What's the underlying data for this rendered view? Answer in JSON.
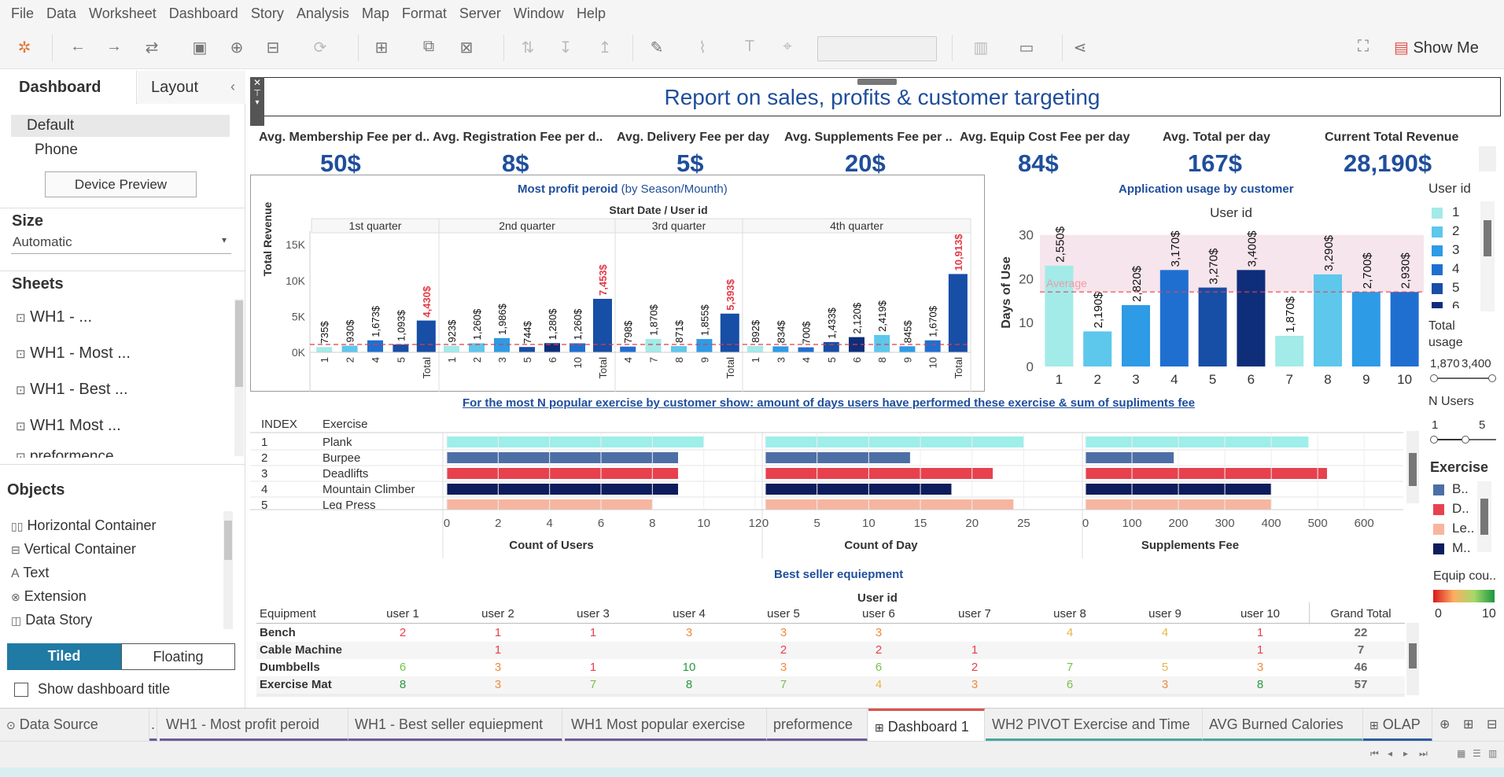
{
  "menu": [
    "File",
    "Data",
    "Worksheet",
    "Dashboard",
    "Story",
    "Analysis",
    "Map",
    "Format",
    "Server",
    "Window",
    "Help"
  ],
  "toolbar": {
    "show_me": "Show Me"
  },
  "left": {
    "tabs": [
      "Dashboard",
      "Layout"
    ],
    "device": {
      "default": "Default",
      "phone": "Phone",
      "preview_button": "Device Preview"
    },
    "size": {
      "title": "Size",
      "value": "Automatic"
    },
    "sheets": {
      "title": "Sheets",
      "items": [
        "WH1 - ...",
        "WH1 - Most ...",
        "WH1 - Best ...",
        "WH1 Most ...",
        "preformence"
      ]
    },
    "objects": {
      "title": "Objects",
      "items": [
        "Horizontal Container",
        "Vertical Container",
        "Text",
        "Extension",
        "Data Story"
      ]
    },
    "tiled": "Tiled",
    "floating": "Floating",
    "show_title": "Show dashboard title"
  },
  "dashboard": {
    "title": "Report on sales, profits & customer targeting",
    "kpis": [
      {
        "label": "Avg. Membership Fee per d..",
        "value": "50$"
      },
      {
        "label": "Avg. Registration Fee per d..",
        "value": "8$"
      },
      {
        "label": "Avg. Delivery Fee per day",
        "value": "5$"
      },
      {
        "label": "Avg. Supplements Fee per ..",
        "value": "20$"
      },
      {
        "label": "Avg. Equip Cost Fee per day",
        "value": "84$"
      },
      {
        "label": "Avg. Total per day",
        "value": "167$"
      },
      {
        "label": "Current Total Revenue",
        "value": "28,190$"
      }
    ],
    "profit_title": "Most profit peroid",
    "profit_subtitle": "(by Season/Mounth)",
    "profit_header": "Start Date  /  User id",
    "usage_title": "Application usage by customer",
    "usage_header": "User id",
    "usage_average": "Average",
    "exercise_title": "For the most N popular exercise by customer show: amount of days users have performed these exercise & sum of supliments fee",
    "equip_title": "Best seller equiepment",
    "equip_header": "User id"
  },
  "chart_data": [
    {
      "type": "bar",
      "ylabel": "Total Revenue",
      "yticks": [
        "15K",
        "10K",
        "5K",
        "0K"
      ],
      "ylim": [
        0,
        16000
      ],
      "quarters": [
        {
          "label": "1st quarter",
          "users": [
            "1",
            "2",
            "4",
            "5",
            "Total"
          ],
          "values": [
            735,
            930,
            1673,
            1093,
            4430
          ],
          "labels": [
            "735$",
            "930$",
            "1,673$",
            "1,093$",
            "4,430$"
          ]
        },
        {
          "label": "2nd quarter",
          "users": [
            "1",
            "2",
            "3",
            "5",
            "6",
            "10",
            "Total"
          ],
          "values": [
            923,
            1260,
            1986,
            744,
            1280,
            1260,
            7453
          ],
          "labels": [
            "923$",
            "1,260$",
            "1,986$",
            "744$",
            "1,280$",
            "1,260$",
            "7,453$"
          ]
        },
        {
          "label": "3rd quarter",
          "users": [
            "4",
            "7",
            "8",
            "9",
            "Total"
          ],
          "values": [
            798,
            1870,
            871,
            1855,
            5393
          ],
          "labels": [
            "798$",
            "1,870$",
            "871$",
            "1,855$",
            "5,393$"
          ]
        },
        {
          "label": "4th quarter",
          "users": [
            "1",
            "3",
            "4",
            "5",
            "6",
            "8",
            "9",
            "10",
            "Total"
          ],
          "values": [
            892,
            834,
            700,
            1433,
            2120,
            2419,
            845,
            1670,
            10913
          ],
          "labels": [
            "892$",
            "834$",
            "700$",
            "1,433$",
            "2,120$",
            "2,419$",
            "845$",
            "1,670$",
            "10,913$"
          ]
        }
      ]
    },
    {
      "type": "bar",
      "ylabel": "Days of Use",
      "yticks": [
        "30",
        "20",
        "10",
        "0"
      ],
      "ylim": [
        0,
        33
      ],
      "categories": [
        "1",
        "2",
        "3",
        "4",
        "5",
        "6",
        "7",
        "8",
        "9",
        "10"
      ],
      "values": [
        23,
        8,
        14,
        22,
        18,
        22,
        7,
        21,
        17,
        17
      ],
      "labels": [
        "2,550$",
        "2,190$",
        "2,820$",
        "3,170$",
        "3,270$",
        "3,400$",
        "1,870$",
        "3,290$",
        "2,700$",
        "2,930$"
      ],
      "average": 17
    },
    {
      "type": "bar",
      "rows": [
        {
          "index": "1",
          "exercise": "Plank",
          "users": 10,
          "days": 25,
          "fee": 480
        },
        {
          "index": "2",
          "exercise": "Burpee",
          "users": 9,
          "days": 14,
          "fee": 190
        },
        {
          "index": "3",
          "exercise": "Deadlifts",
          "users": 9,
          "days": 22,
          "fee": 520
        },
        {
          "index": "4",
          "exercise": "Mountain Climber",
          "users": 9,
          "days": 18,
          "fee": 400
        },
        {
          "index": "5",
          "exercise": "Leg Press",
          "users": 8,
          "days": 24,
          "fee": 400
        }
      ],
      "headers": {
        "index": "INDEX",
        "exercise": "Exercise"
      },
      "axes": [
        {
          "xlabel": "Count of Users",
          "ticks": [
            "0",
            "2",
            "4",
            "6",
            "8",
            "10",
            "12"
          ],
          "max": 12
        },
        {
          "xlabel": "Count of Day",
          "ticks": [
            "0",
            "5",
            "10",
            "15",
            "20",
            "25"
          ],
          "max": 29
        },
        {
          "xlabel": "Supplements Fee",
          "ticks": [
            "0",
            "100",
            "200",
            "300",
            "400",
            "500",
            "600"
          ],
          "max": 620
        }
      ]
    },
    {
      "type": "table",
      "columns": [
        "Equipment",
        "user 1",
        "user 2",
        "user 3",
        "user 4",
        "user 5",
        "user 6",
        "user 7",
        "user 8",
        "user 9",
        "user 10",
        "Grand Total"
      ],
      "rows": [
        {
          "name": "Bench",
          "cells": [
            "2",
            "1",
            "1",
            "3",
            "3",
            "3",
            "",
            "4",
            "4",
            "1"
          ],
          "total": "22"
        },
        {
          "name": "Cable Machine",
          "cells": [
            "",
            "1",
            "",
            "",
            "2",
            "2",
            "1",
            "",
            "",
            "1"
          ],
          "total": "7"
        },
        {
          "name": "Dumbbells",
          "cells": [
            "6",
            "3",
            "1",
            "10",
            "3",
            "6",
            "2",
            "7",
            "5",
            "3"
          ],
          "total": "46"
        },
        {
          "name": "Exercise Mat",
          "cells": [
            "8",
            "3",
            "7",
            "8",
            "7",
            "4",
            "3",
            "6",
            "3",
            "8"
          ],
          "total": "57"
        }
      ]
    }
  ],
  "legends": {
    "user_title": "User id",
    "user_items": [
      "1",
      "2",
      "3",
      "4",
      "5",
      "6"
    ],
    "total_usage": "Total usage",
    "total_usage_range": "1,870",
    "total_usage_range2": "3,400",
    "n_users": "N Users",
    "n_min": "1",
    "n_max": "5",
    "exercise_title": "Exercise",
    "exercise_items": [
      "B..",
      "D..",
      "Le..",
      "M.."
    ],
    "equip_title": "Equip cou..",
    "equip_min": "0",
    "equip_max": "10"
  },
  "colors": {
    "u1": "#a2ebe8",
    "u2": "#5dc7ec",
    "u3": "#2d9be6",
    "u4": "#1f6fd1",
    "u5": "#174ea6",
    "u6": "#0e2e7a",
    "plank": "#9eeeea",
    "burpee": "#4c6fa6",
    "deadlifts": "#e8414e",
    "mountain": "#0d1c5c",
    "leg": "#f7b5a0",
    "title": "#1f4e9b"
  },
  "bottom_tabs": [
    "Data Source",
    "WH1 - Most profit peroid",
    "WH1 - Best seller equiepment",
    "WH1 Most popular exercise",
    "preformence",
    "Dashboard 1",
    "WH2 PIVOT Exercise and Time",
    "AVG Burned Calories",
    "OLAP"
  ]
}
